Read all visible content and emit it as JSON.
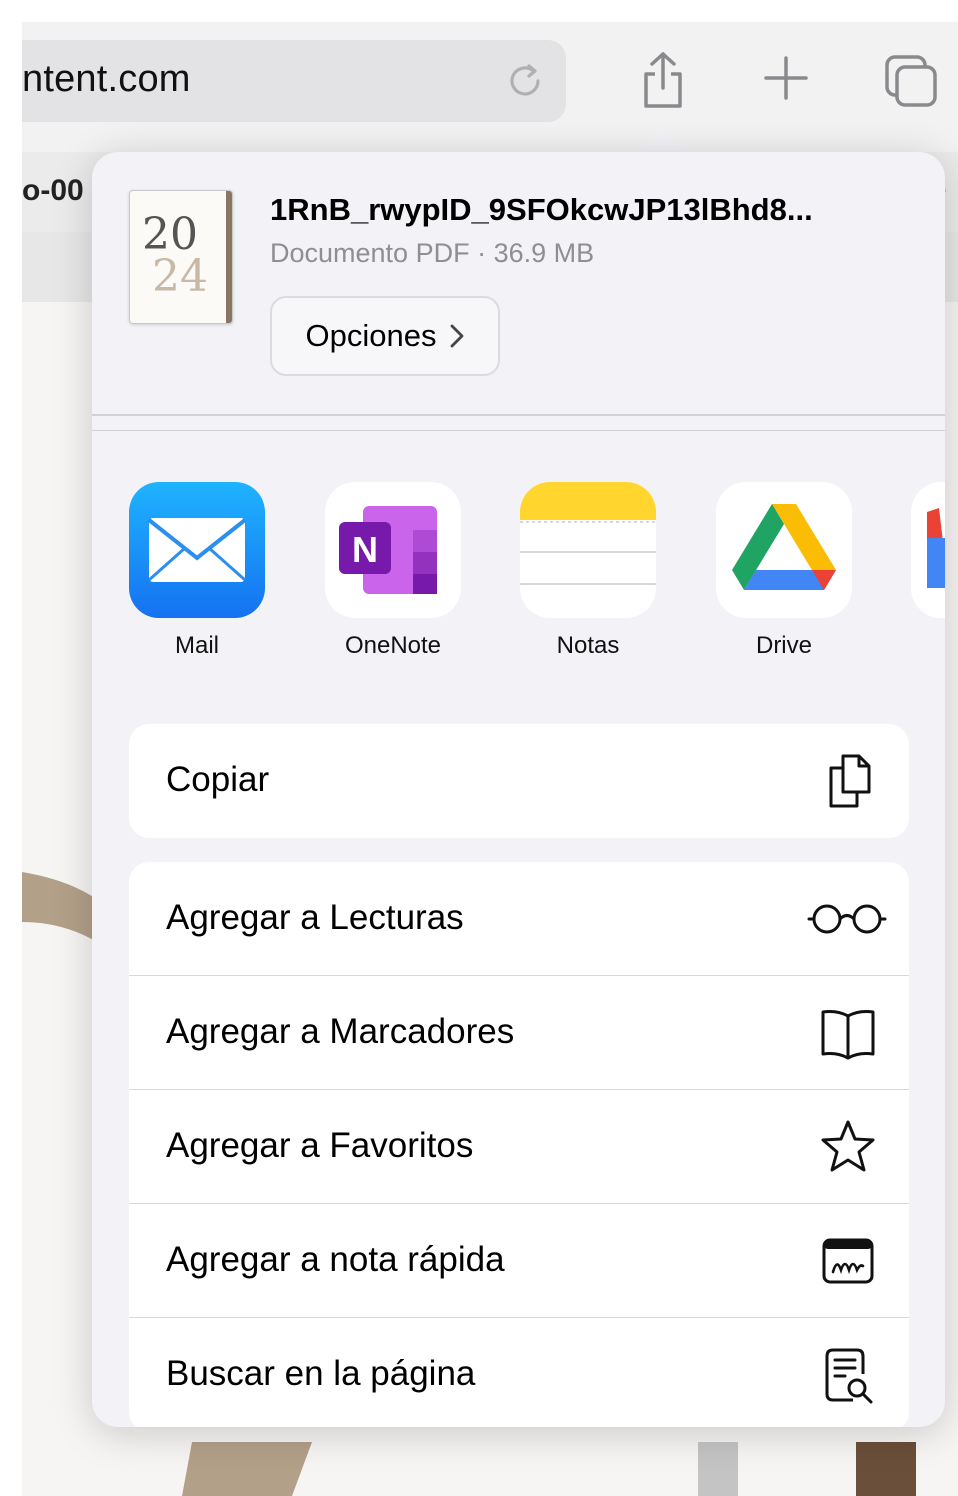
{
  "browser": {
    "url_text": "ntent.com",
    "tab_label": "o-00",
    "tab_label_right": "."
  },
  "toolbar_icons": [
    "reload-icon",
    "share-icon",
    "new-tab-icon",
    "tabs-overview-icon"
  ],
  "share_sheet": {
    "file_name": "1RnB_rwypID_9SFOkcwJP13lBhd8...",
    "file_type": "Documento PDF",
    "separator": " · ",
    "file_size": "36.9 MB",
    "thumbnail": {
      "top": "20",
      "bottom": "24"
    },
    "options_label": "Opciones",
    "apps": [
      {
        "label": "Mail",
        "icon": "mail-app-icon",
        "color": "#1a8cf5"
      },
      {
        "label": "OneNote",
        "icon": "onenote-app-icon",
        "color": "#7719aa"
      },
      {
        "label": "Notas",
        "icon": "notes-app-icon",
        "color": "#ffd52e"
      },
      {
        "label": "Drive",
        "icon": "google-drive-app-icon",
        "color": "#1fa463"
      }
    ],
    "copy_action": {
      "label": "Copiar",
      "icon": "copy-icon"
    },
    "actions": [
      {
        "label": "Agregar a Lecturas",
        "icon": "glasses-icon"
      },
      {
        "label": "Agregar a Marcadores",
        "icon": "book-icon"
      },
      {
        "label": "Agregar a Favoritos",
        "icon": "star-icon"
      },
      {
        "label": "Agregar a nota rápida",
        "icon": "quick-note-icon"
      },
      {
        "label": "Buscar en la página",
        "icon": "find-in-page-icon"
      }
    ]
  }
}
